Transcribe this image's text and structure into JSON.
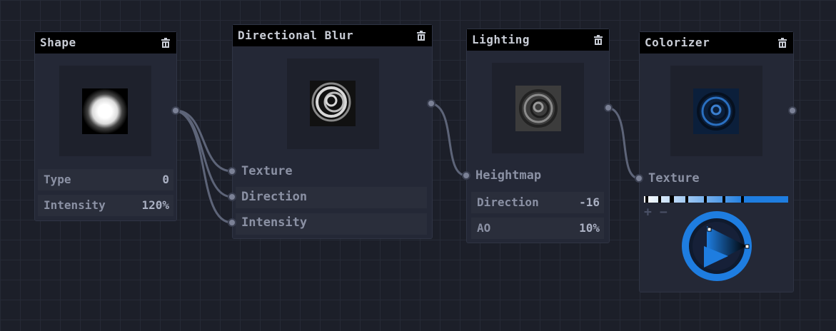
{
  "nodes": {
    "shape": {
      "title": "Shape",
      "params": [
        {
          "label": "Type",
          "value": "0"
        },
        {
          "label": "Intensity",
          "value": "120%"
        }
      ]
    },
    "blur": {
      "title": "Directional Blur",
      "inputs": [
        "Texture",
        "Direction",
        "Intensity"
      ]
    },
    "lighting": {
      "title": "Lighting",
      "inputs": [
        "Heightmap"
      ],
      "params": [
        {
          "label": "Direction",
          "value": "-16"
        },
        {
          "label": "AO",
          "value": "10%"
        }
      ]
    },
    "colorizer": {
      "title": "Colorizer",
      "inputs": [
        "Texture"
      ],
      "gradient": {
        "start_color": "#ffffff",
        "end_color": "#1e7de0"
      },
      "add_label": "+",
      "remove_label": "−"
    }
  },
  "accent_color": "#1e7de0",
  "icons": {
    "delete": "trash-icon",
    "play": "play-icon"
  }
}
